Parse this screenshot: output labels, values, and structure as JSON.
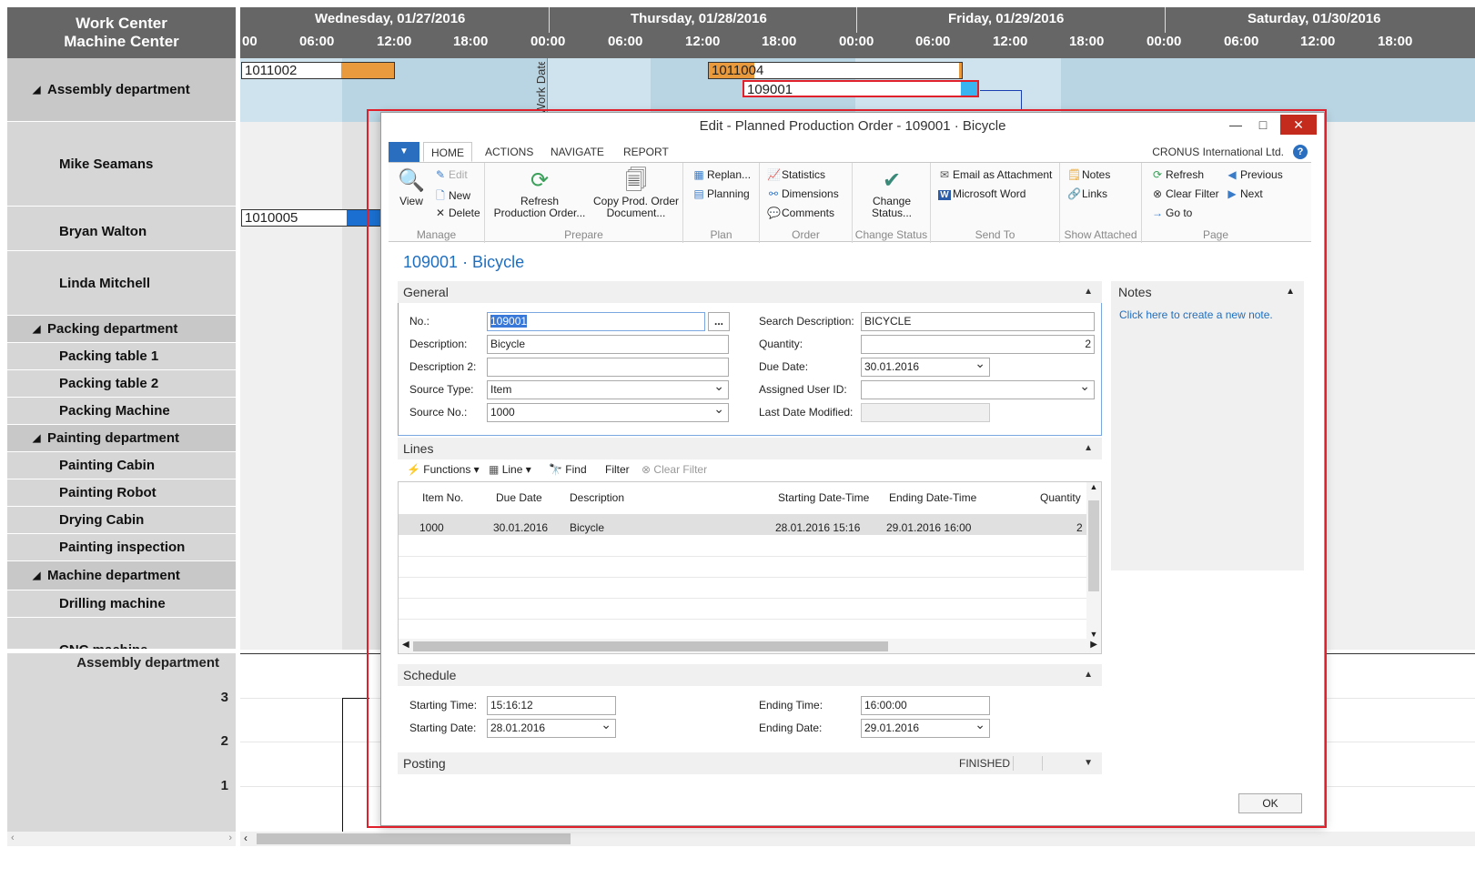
{
  "tree": {
    "header_line1": "Work Center",
    "header_line2": "Machine Center",
    "rows": [
      {
        "label": "Assembly department"
      },
      {
        "label": "Mike Seamans"
      },
      {
        "label": "Bryan Walton"
      },
      {
        "label": "Linda Mitchell"
      },
      {
        "label": "Packing department"
      },
      {
        "label": "Packing table 1"
      },
      {
        "label": "Packing table 2"
      },
      {
        "label": "Packing Machine"
      },
      {
        "label": "Painting department"
      },
      {
        "label": "Painting Cabin"
      },
      {
        "label": "Painting Robot"
      },
      {
        "label": "Drying Cabin"
      },
      {
        "label": "Painting inspection"
      },
      {
        "label": "Machine department"
      },
      {
        "label": "Drilling machine"
      },
      {
        "label": "CNC machine"
      }
    ]
  },
  "timeline": {
    "days": [
      "Wednesday, 01/27/2016",
      "Thursday, 01/28/2016",
      "Friday, 01/29/2016",
      "Saturday, 01/30/2016"
    ],
    "hours": [
      "00",
      "06:00",
      "12:00",
      "18:00",
      "00:00",
      "06:00",
      "12:00",
      "18:00",
      "00:00",
      "06:00",
      "12:00",
      "18:00",
      "00:00",
      "06:00",
      "12:00",
      "18:00"
    ],
    "bars": [
      {
        "label": "1011002",
        "color": "#e89a3c"
      },
      {
        "label": "1011004",
        "color": "#e89a3c"
      },
      {
        "label": "109001",
        "color": "#3ab4f0"
      },
      {
        "label": "1010005",
        "color": "#1a6fd0"
      }
    ],
    "work_date_label": "Work Date"
  },
  "chart": {
    "title": "Assembly department",
    "yticks": [
      "3",
      "2",
      "1"
    ]
  },
  "dialog": {
    "title": "Edit - Planned Production Order - 109001 · Bicycle",
    "window_buttons": {
      "minimize": "—",
      "maximize": "□",
      "close": "✕"
    },
    "tabs": [
      "HOME",
      "ACTIONS",
      "NAVIGATE",
      "REPORT"
    ],
    "company": "CRONUS International Ltd.",
    "ribbon": {
      "manage": {
        "label": "Manage",
        "view": "View",
        "edit": "Edit",
        "new": "New",
        "delete": "Delete"
      },
      "prepare": {
        "label": "Prepare",
        "refresh_line1": "Refresh",
        "refresh_line2": "Production Order...",
        "copy_line1": "Copy Prod. Order",
        "copy_line2": "Document..."
      },
      "plan": {
        "label": "Plan",
        "replan": "Replan...",
        "planning": "Planning"
      },
      "order": {
        "label": "Order",
        "statistics": "Statistics",
        "dimensions": "Dimensions",
        "comments": "Comments"
      },
      "change_status": {
        "label": "Change Status",
        "btn_line1": "Change",
        "btn_line2": "Status..."
      },
      "send_to": {
        "label": "Send To",
        "email": "Email as Attachment",
        "word": "Microsoft Word"
      },
      "show_attached": {
        "label": "Show Attached",
        "notes": "Notes",
        "links": "Links"
      },
      "page": {
        "label": "Page",
        "refresh": "Refresh",
        "clear_filter": "Clear Filter",
        "go_to": "Go to",
        "previous": "Previous",
        "next": "Next"
      }
    },
    "page_title": "109001 · Bicycle",
    "general": {
      "title": "General",
      "no_label": "No.:",
      "no_value": "109001",
      "description_label": "Description:",
      "description_value": "Bicycle",
      "description2_label": "Description 2:",
      "description2_value": "",
      "source_type_label": "Source Type:",
      "source_type_value": "Item",
      "source_no_label": "Source No.:",
      "source_no_value": "1000",
      "search_desc_label": "Search Description:",
      "search_desc_value": "BICYCLE",
      "quantity_label": "Quantity:",
      "quantity_value": "2",
      "due_date_label": "Due Date:",
      "due_date_value": "30.01.2016",
      "assigned_user_label": "Assigned User ID:",
      "assigned_user_value": "",
      "last_modified_label": "Last Date Modified:",
      "last_modified_value": "",
      "lookup_btn": "..."
    },
    "notes": {
      "title": "Notes",
      "link": "Click here to create a new note."
    },
    "lines": {
      "title": "Lines",
      "toolbar": {
        "functions": "Functions",
        "line": "Line",
        "find": "Find",
        "filter": "Filter",
        "clear_filter": "Clear Filter"
      },
      "headers": [
        "Item No.",
        "Due Date",
        "Description",
        "Starting Date-Time",
        "Ending Date-Time",
        "Quantity"
      ],
      "rows": [
        {
          "item_no": "1000",
          "due_date": "30.01.2016",
          "description": "Bicycle",
          "start": "28.01.2016 15:16",
          "end": "29.01.2016 16:00",
          "quantity": "2"
        }
      ]
    },
    "schedule": {
      "title": "Schedule",
      "starting_time_label": "Starting Time:",
      "starting_time_value": "15:16:12",
      "starting_date_label": "Starting Date:",
      "starting_date_value": "28.01.2016",
      "ending_time_label": "Ending Time:",
      "ending_time_value": "16:00:00",
      "ending_date_label": "Ending Date:",
      "ending_date_value": "29.01.2016"
    },
    "posting": {
      "title": "Posting",
      "status": "FINISHED"
    },
    "ok_label": "OK"
  }
}
